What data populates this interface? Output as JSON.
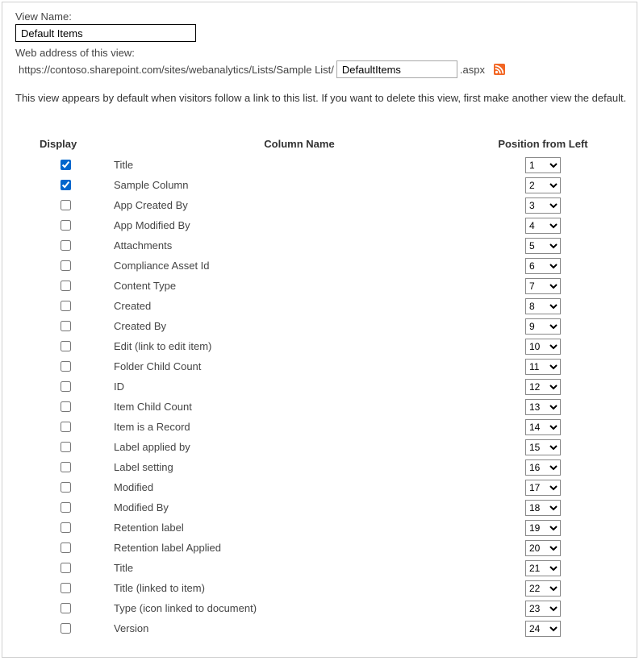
{
  "form": {
    "view_name_label": "View Name:",
    "view_name_value": "Default Items",
    "web_address_label": "Web address of this view:",
    "url_prefix": "https://contoso.sharepoint.com/sites/webanalytics/Lists/Sample List/",
    "url_slug_value": "DefaultItems",
    "url_suffix": ".aspx",
    "rss_icon": "rss-icon",
    "hint": "This view appears by default when visitors follow a link to this list. If you want to delete this view, first make another view the default."
  },
  "table": {
    "headers": {
      "display": "Display",
      "column_name": "Column Name",
      "position": "Position from Left"
    },
    "rows": [
      {
        "checked": true,
        "name": "Title",
        "position": "1"
      },
      {
        "checked": true,
        "name": "Sample Column",
        "position": "2"
      },
      {
        "checked": false,
        "name": "App Created By",
        "position": "3"
      },
      {
        "checked": false,
        "name": "App Modified By",
        "position": "4"
      },
      {
        "checked": false,
        "name": "Attachments",
        "position": "5"
      },
      {
        "checked": false,
        "name": "Compliance Asset Id",
        "position": "6"
      },
      {
        "checked": false,
        "name": "Content Type",
        "position": "7"
      },
      {
        "checked": false,
        "name": "Created",
        "position": "8"
      },
      {
        "checked": false,
        "name": "Created By",
        "position": "9"
      },
      {
        "checked": false,
        "name": "Edit (link to edit item)",
        "position": "10"
      },
      {
        "checked": false,
        "name": "Folder Child Count",
        "position": "11"
      },
      {
        "checked": false,
        "name": "ID",
        "position": "12"
      },
      {
        "checked": false,
        "name": "Item Child Count",
        "position": "13"
      },
      {
        "checked": false,
        "name": "Item is a Record",
        "position": "14"
      },
      {
        "checked": false,
        "name": "Label applied by",
        "position": "15"
      },
      {
        "checked": false,
        "name": "Label setting",
        "position": "16"
      },
      {
        "checked": false,
        "name": "Modified",
        "position": "17"
      },
      {
        "checked": false,
        "name": "Modified By",
        "position": "18"
      },
      {
        "checked": false,
        "name": "Retention label",
        "position": "19"
      },
      {
        "checked": false,
        "name": "Retention label Applied",
        "position": "20"
      },
      {
        "checked": false,
        "name": "Title",
        "position": "21"
      },
      {
        "checked": false,
        "name": "Title (linked to item)",
        "position": "22"
      },
      {
        "checked": false,
        "name": "Type (icon linked to document)",
        "position": "23"
      },
      {
        "checked": false,
        "name": "Version",
        "position": "24"
      }
    ]
  }
}
